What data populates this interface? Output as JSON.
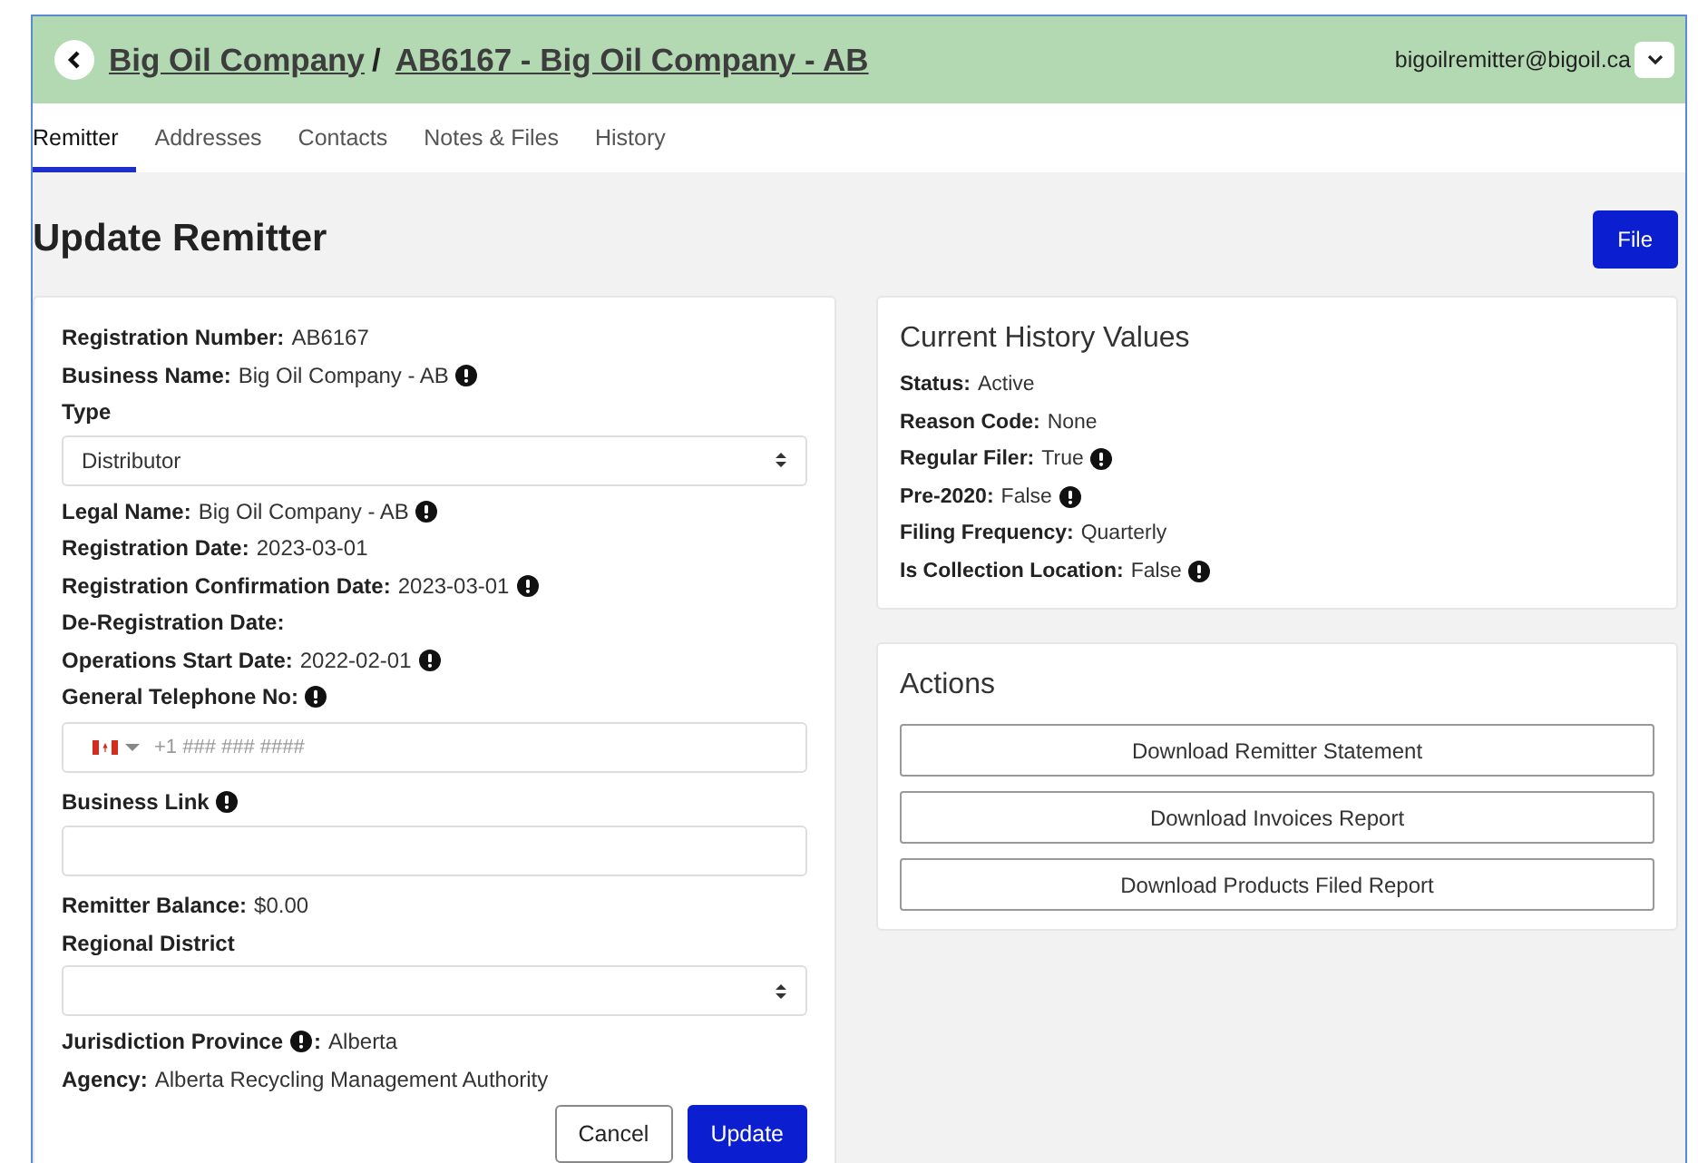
{
  "header": {
    "breadcrumbs": [
      "Big Oil Company ",
      "AB6167 - Big Oil Company - AB"
    ],
    "separator": "/",
    "user": "bigoilremitter@bigoil.ca"
  },
  "tabs": [
    {
      "label": "Remitter",
      "selected": true
    },
    {
      "label": "Addresses",
      "selected": false
    },
    {
      "label": "Contacts",
      "selected": false
    },
    {
      "label": "Notes & Files",
      "selected": false
    },
    {
      "label": "History",
      "selected": false
    }
  ],
  "page_title": "Update Remitter",
  "file_button": "File",
  "form": {
    "rows": [
      {
        "kind": "info",
        "label": "Registration Number:",
        "value": "AB6167",
        "info_after_label": false,
        "info_after_value": false
      },
      {
        "kind": "info",
        "label": "Business Name:",
        "value": "Big Oil Company - AB",
        "info_after_label": false,
        "info_after_value": true
      },
      {
        "kind": "select",
        "label": "Type",
        "value": "Distributor",
        "info_after_label": false,
        "info_after_value": false
      },
      {
        "kind": "info",
        "label": "Legal Name:",
        "value": "Big Oil Company - AB",
        "info_after_label": false,
        "info_after_value": true
      },
      {
        "kind": "info",
        "label": "Registration Date:",
        "value": "2023-03-01",
        "info_after_label": false,
        "info_after_value": false
      },
      {
        "kind": "info",
        "label": "Registration Confirmation Date:",
        "value": "2023-03-01",
        "info_after_label": false,
        "info_after_value": true
      },
      {
        "kind": "info",
        "label": "De-Registration Date:",
        "info_after_label": false,
        "info_after_value": false
      },
      {
        "kind": "info",
        "label": "Operations Start Date:",
        "value": "2022-02-01",
        "info_after_label": false,
        "info_after_value": true
      },
      {
        "kind": "phone",
        "label": "General Telephone No:",
        "placeholder": "+1 ### ### ####",
        "info_after_label": true,
        "info_after_value": false
      },
      {
        "kind": "text",
        "label": "Business Link",
        "info_after_label": true,
        "info_after_value": false
      },
      {
        "kind": "info",
        "label": "Remitter Balance:",
        "value": "$0.00",
        "info_after_label": false,
        "info_after_value": false
      },
      {
        "kind": "select",
        "label": "Regional District",
        "info_after_label": false,
        "info_after_value": false
      },
      {
        "kind": "info",
        "label": "Jurisdiction Province",
        "label_tail": ":",
        "value": "Alberta",
        "info_after_label": true,
        "info_after_value": false
      },
      {
        "kind": "info",
        "label": "Agency:",
        "value": "Alberta Recycling Management Authority",
        "info_after_label": false,
        "info_after_value": false
      }
    ],
    "buttons": [
      {
        "label": "Cancel",
        "kind": "secondary"
      },
      {
        "label": "Update",
        "kind": "primary"
      }
    ]
  },
  "history": {
    "title": "Current History Values",
    "rows": [
      {
        "label": "Status:",
        "value": "Active",
        "info_after_value": false
      },
      {
        "label": "Reason Code:",
        "value": "None",
        "info_after_value": false
      },
      {
        "label": "Regular Filer:",
        "value": "True",
        "info_after_value": true
      },
      {
        "label": "Pre-2020:",
        "value": "False",
        "info_after_value": true
      },
      {
        "label": "Filing Frequency:",
        "value": "Quarterly",
        "info_after_value": false
      },
      {
        "label": "Is Collection Location:",
        "value": "False",
        "info_after_value": true
      }
    ]
  },
  "actions": {
    "title": "Actions",
    "buttons": [
      "Download Remitter Statement",
      "Download Invoices Report",
      "Download Products Filed Report"
    ]
  }
}
